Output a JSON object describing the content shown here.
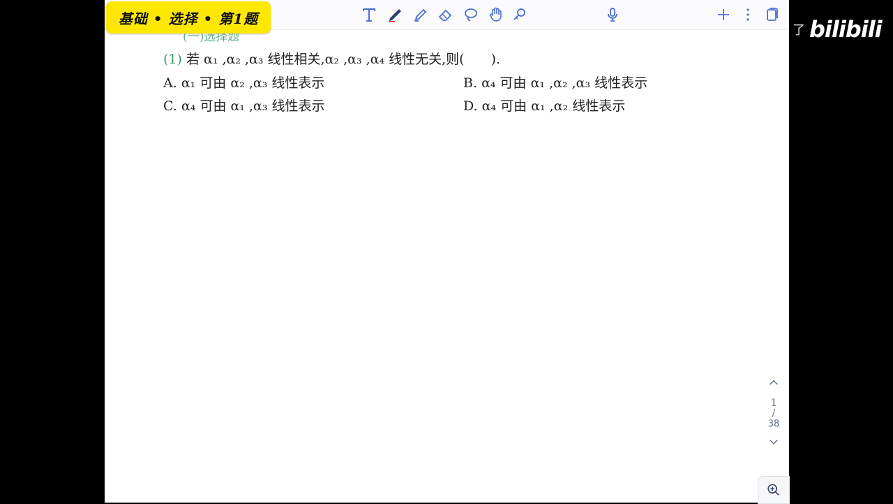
{
  "header": {
    "title_badge": "基础 • 选择 • 第1题"
  },
  "toolbar": {
    "tools": [
      "text-tool-icon",
      "pen-tool-icon",
      "highlighter-tool-icon",
      "eraser-tool-icon",
      "lasso-tool-icon",
      "hand-tool-icon",
      "shape-tool-icon",
      "microphone-icon",
      "add-icon",
      "more-icon",
      "pages-icon"
    ],
    "accent_color": "#4a6fd1"
  },
  "watermark": {
    "prefix": "了",
    "logo": "bilibili"
  },
  "question": {
    "section_heading_partial": "(一)选择题",
    "number": "(1)",
    "stem": "若 α₁ ,α₂ ,α₃ 线性相关,α₂ ,α₃ ,α₄ 线性无关,则(　　).",
    "options": [
      {
        "label": "A.",
        "text": "α₁ 可由 α₂ ,α₃ 线性表示"
      },
      {
        "label": "B.",
        "text": "α₄ 可由 α₁ ,α₂ ,α₃ 线性表示"
      },
      {
        "label": "C.",
        "text": "α₄ 可由 α₁ ,α₃ 线性表示"
      },
      {
        "label": "D.",
        "text": "α₄ 可由 α₁ ,α₂ 线性表示"
      }
    ]
  },
  "pager": {
    "current": "1",
    "separator": "/",
    "total": "38"
  }
}
